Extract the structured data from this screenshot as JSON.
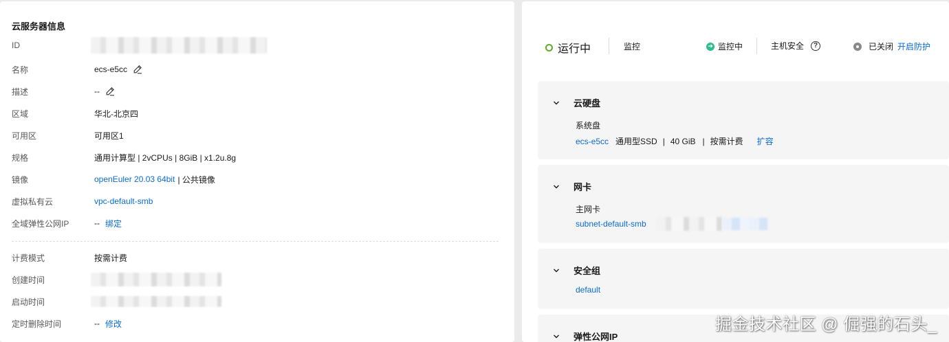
{
  "server_info": {
    "title": "云服务器信息",
    "rows": [
      {
        "label": "ID"
      },
      {
        "label": "名称",
        "value": "ecs-e5cc"
      },
      {
        "label": "描述",
        "value": "--"
      },
      {
        "label": "区域",
        "value": "华北-北京四"
      },
      {
        "label": "可用区",
        "value": "可用区1"
      },
      {
        "label": "规格",
        "value": "通用计算型 | 2vCPUs | 8GiB | x1.2u.8g"
      },
      {
        "label": "镜像",
        "link": "openEuler 20.03 64bit",
        "suffix": "| 公共镜像"
      },
      {
        "label": "虚拟私有云",
        "link": "vpc-default-smb"
      },
      {
        "label": "全域弹性公网IP",
        "value": "--",
        "link": "绑定"
      }
    ],
    "billing_rows": [
      {
        "label": "计费模式",
        "value": "按需计费"
      },
      {
        "label": "创建时间"
      },
      {
        "label": "启动时间"
      },
      {
        "label": "定时删除时间",
        "value": "--",
        "link": "修改"
      }
    ]
  },
  "status_bar": {
    "running": "运行中",
    "monitor_label": "监控",
    "monitor_status": "监控中",
    "host_security": "主机安全",
    "security_status": "已关闭",
    "enable_protection": "开启防护"
  },
  "sections": {
    "disk": {
      "title": "云硬盘",
      "sub_label": "系统盘",
      "disk_name": "ecs-e5cc",
      "disk_type": "通用型SSD",
      "disk_size": "40 GiB",
      "disk_billing": "按需计费",
      "expand": "扩容"
    },
    "nic": {
      "title": "网卡",
      "sub_label": "主网卡",
      "subnet": "subnet-default-smb"
    },
    "security_group": {
      "title": "安全组",
      "group": "default"
    },
    "eip": {
      "title": "弹性公网IP"
    }
  },
  "watermark": "掘金技术社区 @ 倔强的石头_",
  "colors": {
    "link": "#0a6bd3",
    "running": "#5daa2d",
    "monitoring": "#2dbd8f"
  }
}
